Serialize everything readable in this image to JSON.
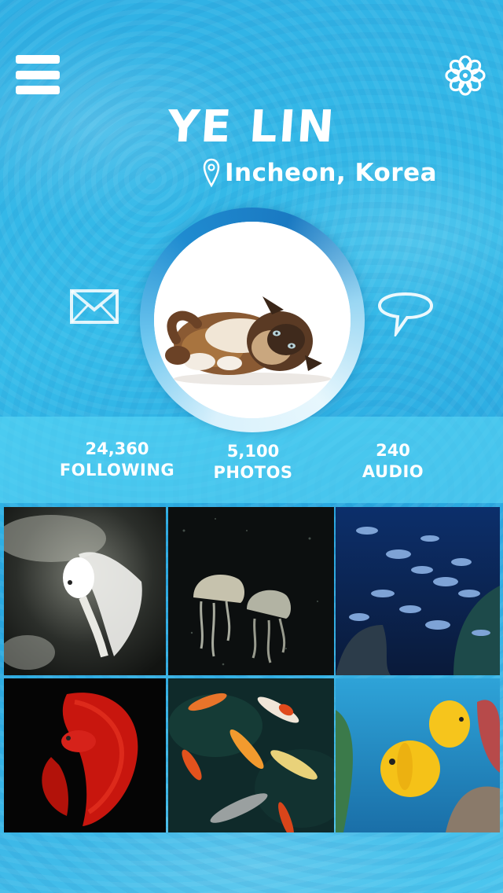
{
  "header": {
    "menu_icon": "hamburger-menu-icon",
    "settings_icon": "flower-gear-icon"
  },
  "profile": {
    "name": "YE LIN",
    "location": "Incheon, Korea",
    "location_icon": "location-pin-icon",
    "avatar": "cat-photo",
    "message_icon": "mail-envelope-icon",
    "comment_icon": "speech-bubble-icon"
  },
  "stats": [
    {
      "value": "24,360",
      "label": "FOLLOWING"
    },
    {
      "value": "5,100",
      "label": "PHOTOS"
    },
    {
      "value": "240",
      "label": "AUDIO"
    }
  ],
  "gallery": [
    {
      "subject": "white betta fish"
    },
    {
      "subject": "jellyfish"
    },
    {
      "subject": "school of fish on reef"
    },
    {
      "subject": "red betta fish"
    },
    {
      "subject": "koi fish"
    },
    {
      "subject": "yellow butterflyfish"
    }
  ],
  "colors": {
    "accent_blue": "#2fb0e4",
    "stats_bar": "#58d6f6",
    "ring_blue": "#1a79c2"
  }
}
